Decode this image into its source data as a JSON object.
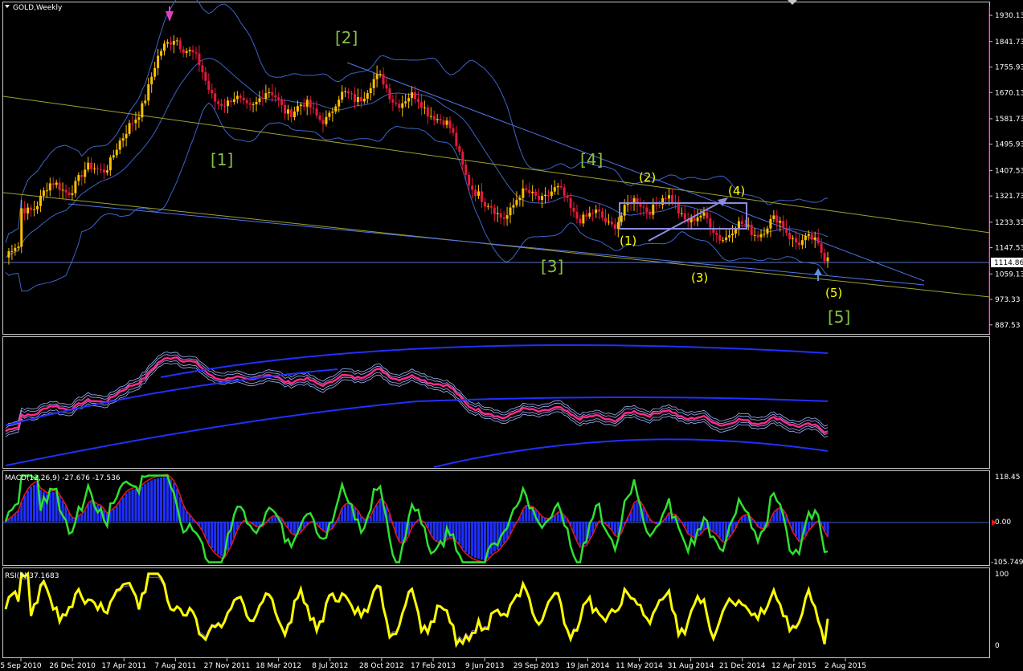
{
  "colors": {
    "background": "#000000",
    "frame": "#c8c8c8",
    "bull": "#ffc000",
    "bear": "#e8183c",
    "band": "#3c64c8",
    "trend_blue": "#5078f0",
    "trend_yellow": "#a0a030",
    "wave_green": "#88c040",
    "wave_yellow": "#ffff00",
    "macd_hist": "#2030ff",
    "macd_fast": "#30e030",
    "macd_slow": "#e81818",
    "rsi_line": "#ffff00",
    "pink": "#ff2a8a",
    "ma_blue": "#2030ff",
    "text": "#ffffff"
  },
  "main": {
    "title": "GOLD,Weekly",
    "price_ticks": [
      "1930.13",
      "1841.73",
      "1755.93",
      "1670.13",
      "1581.73",
      "1495.93",
      "1407.53",
      "1321.73",
      "1233.33",
      "1147.53",
      "1059.13",
      "973.33",
      "887.53"
    ],
    "current_price": "1114.86",
    "wave_labels_green": [
      "[1]",
      "[2]",
      "[3]",
      "[4]",
      "[5]"
    ],
    "wave_labels_yellow": [
      "(1)",
      "(2)",
      "(3)",
      "(4)",
      "(5)"
    ]
  },
  "macd": {
    "header": "MACD(12,26,9) -27.676 -17.536",
    "ticks": [
      "118.45",
      "0.00",
      "-105.749"
    ]
  },
  "rsi": {
    "header": "RSI(5) 37.1683",
    "ticks": [
      "100",
      "0"
    ]
  },
  "chart_data": {
    "type": "candlestick",
    "title": "GOLD,Weekly",
    "x_ticks": [
      "5 Sep 2010",
      "26 Dec 2010",
      "17 Apr 2011",
      "7 Aug 2011",
      "27 Nov 2011",
      "18 Mar 2012",
      "8 Jul 2012",
      "28 Oct 2012",
      "17 Feb 2013",
      "9 Jun 2013",
      "29 Sep 2013",
      "19 Jan 2014",
      "11 May 2014",
      "31 Aug 2014",
      "21 Dec 2014",
      "12 Apr 2015",
      "2 Aug 2015"
    ],
    "y_range": [
      860,
      1960
    ],
    "close_path": [
      [
        "5 Sep 2010",
        1250
      ],
      [
        "26 Dec 2010",
        1385
      ],
      [
        "17 Apr 2011",
        1480
      ],
      [
        "7 Aug 2011",
        1900
      ],
      [
        "27 Nov 2011",
        1600
      ],
      [
        "18 Mar 2012",
        1660
      ],
      [
        "8 Jul 2012",
        1590
      ],
      [
        "28 Oct 2012",
        1710
      ],
      [
        "17 Feb 2013",
        1610
      ],
      [
        "9 Jun 2013",
        1280
      ],
      [
        "29 Sep 2013",
        1330
      ],
      [
        "19 Jan 2014",
        1250
      ],
      [
        "11 May 2014",
        1290
      ],
      [
        "31 Aug 2014",
        1260
      ],
      [
        "21 Dec 2014",
        1200
      ],
      [
        "12 Apr 2015",
        1200
      ],
      [
        "2 Aug 2015",
        1114.86
      ]
    ],
    "macd_range": [
      -105.749,
      118.45
    ],
    "rsi_range": [
      0,
      100
    ]
  }
}
